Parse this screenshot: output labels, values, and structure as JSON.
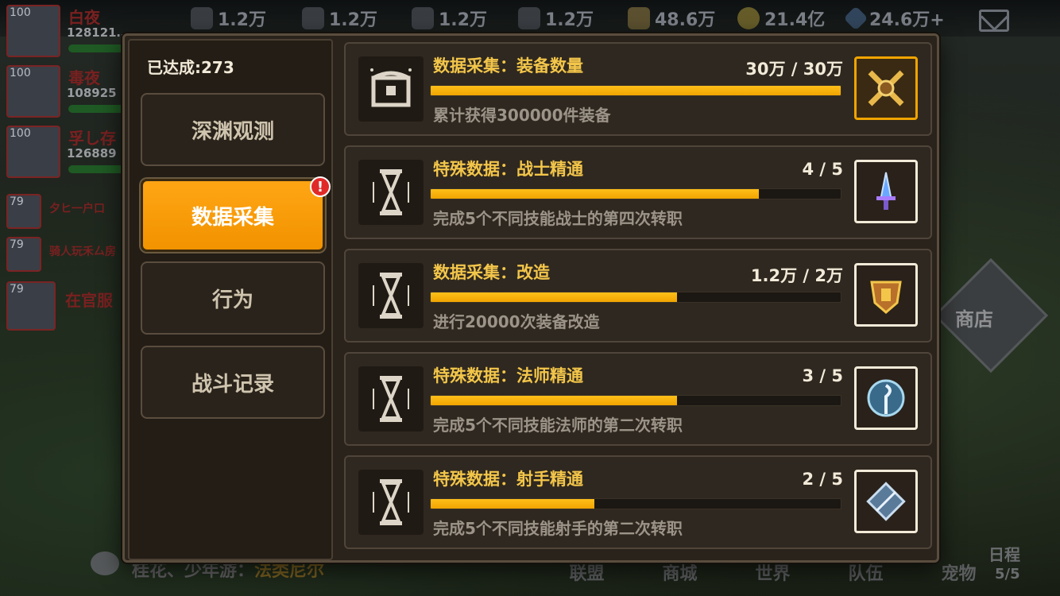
{
  "resources": [
    {
      "icon": "stone-icon",
      "value": "1.2万"
    },
    {
      "icon": "ore-icon",
      "value": "1.2万"
    },
    {
      "icon": "crystal-icon",
      "value": "1.2万"
    },
    {
      "icon": "wood-icon",
      "value": "1.2万"
    },
    {
      "icon": "wheat-icon",
      "value": "48.6万"
    },
    {
      "icon": "gold-coin-icon",
      "value": "21.4亿"
    },
    {
      "icon": "gem-icon",
      "value": "24.6万+"
    }
  ],
  "players": [
    {
      "level": "100",
      "name": "白夜",
      "power": "128121…"
    },
    {
      "level": "100",
      "name": "毒夜",
      "power": "108925"
    },
    {
      "level": "100",
      "name": "孚し存",
      "power": "126889"
    },
    {
      "level": "79",
      "name": "夕ヒ一户口"
    },
    {
      "level": "79",
      "name": "骑人玩禾厶房"
    },
    {
      "level": "79",
      "name": "在官服"
    }
  ],
  "background": {
    "shop_label": "商店",
    "chat_prefix": "桂花、少年游：",
    "chat_highlight": "法类尼尔",
    "nav": [
      "联盟",
      "商城",
      "世界",
      "队伍",
      "宠物"
    ],
    "schedule_label": "日程",
    "schedule_count": "5/5"
  },
  "sidebar": {
    "achieved_label": "已达成:273",
    "tabs": [
      {
        "label": "深渊观测",
        "active": false
      },
      {
        "label": "数据采集",
        "active": true,
        "badge": "!"
      },
      {
        "label": "行为",
        "active": false
      },
      {
        "label": "战斗记录",
        "active": false
      }
    ]
  },
  "achievements": [
    {
      "icon": "chest-icon",
      "title": "数据采集：装备数量",
      "progress": "30万 / 30万",
      "fraction": 1.0,
      "desc": "累计获得300000件装备",
      "reward_icon": "crossed-swords-reward-icon",
      "completed": true
    },
    {
      "icon": "hourglass-icon",
      "title": "特殊数据：战士精通",
      "progress": "4 / 5",
      "fraction": 0.8,
      "desc": "完成5个不同技能战士的第四次转职",
      "reward_icon": "sword-reward-icon",
      "completed": false
    },
    {
      "icon": "hourglass-icon",
      "title": "数据采集：改造",
      "progress": "1.2万 / 2万",
      "fraction": 0.6,
      "desc": "进行20000次装备改造",
      "reward_icon": "anvil-crest-reward-icon",
      "completed": false
    },
    {
      "icon": "hourglass-icon",
      "title": "特殊数据：法师精通",
      "progress": "3 / 5",
      "fraction": 0.6,
      "desc": "完成5个不同技能法师的第二次转职",
      "reward_icon": "staff-reward-icon",
      "completed": false
    },
    {
      "icon": "hourglass-icon",
      "title": "特殊数据：射手精通",
      "progress": "2 / 5",
      "fraction": 0.4,
      "desc": "完成5个不同技能射手的第二次转职",
      "reward_icon": "bow-reward-icon",
      "completed": false
    }
  ],
  "colors": {
    "accent": "#f5a000",
    "title": "#f3c64a",
    "badge": "#e02a28"
  }
}
